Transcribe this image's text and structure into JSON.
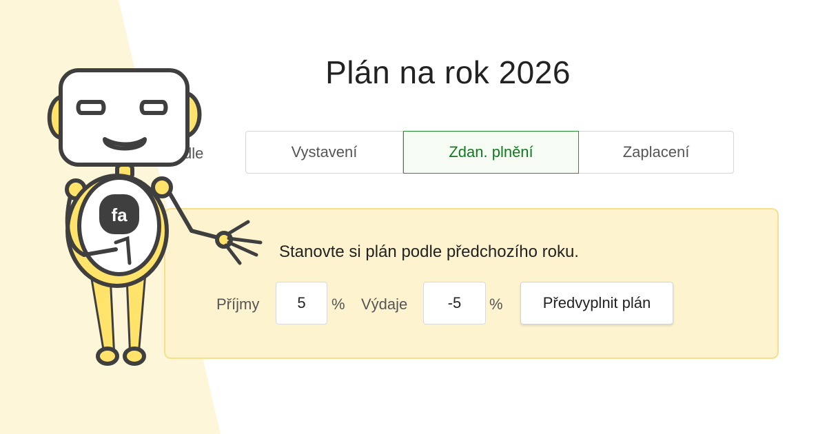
{
  "header": {
    "title": "Plán na rok 2026"
  },
  "mode": {
    "label_partial": "dle",
    "tabs": [
      {
        "label": "Vystavení",
        "active": false
      },
      {
        "label": "Zdan. plnění",
        "active": true
      },
      {
        "label": "Zaplacení",
        "active": false
      }
    ]
  },
  "panel": {
    "message": "Stanovte si plán podle předchozího roku.",
    "income": {
      "label": "Příjmy",
      "value": "5",
      "unit": "%"
    },
    "expenses": {
      "label": "Výdaje",
      "value": "-5",
      "unit": "%"
    },
    "prefill_button": "Předvyplnit plán",
    "logo_text": "fa"
  },
  "colors": {
    "accent_green": "#0f7a1f",
    "panel_bg": "#fdf4cf",
    "panel_border": "#f5e08a",
    "left_band": "#fdf6d8",
    "robot_yellow": "#ffe36a",
    "robot_outline": "#3f3f3f"
  },
  "icons": {
    "mascot": "robot-mascot"
  }
}
